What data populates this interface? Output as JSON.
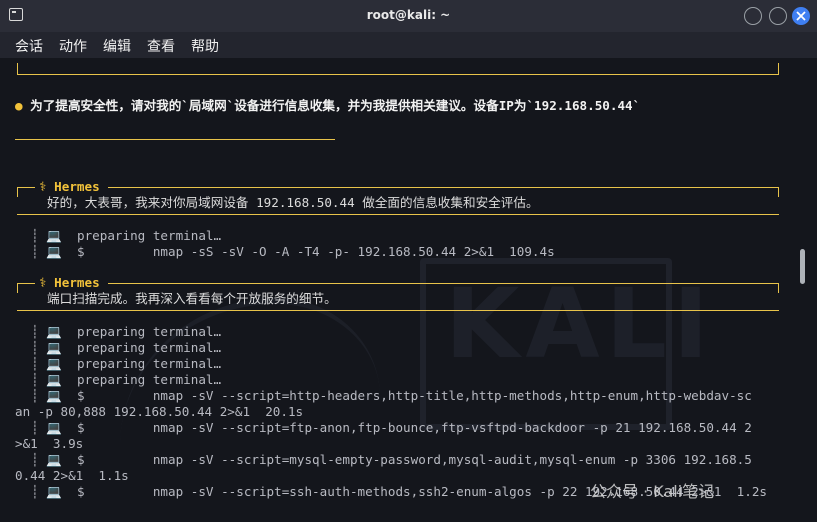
{
  "window": {
    "title": "root@kali: ~",
    "accent_close": "#3f7ff2"
  },
  "menu": [
    "会话",
    "动作",
    "编辑",
    "查看",
    "帮助"
  ],
  "terminal": {
    "user_prompt": "为了提高安全性，请对我的`局域网`设备进行信息收集，并为我提供相关建议。设备IP为`192.168.50.44`",
    "agent_name": "⚕ Hermes",
    "reply1": "好的，大表哥，我来对你局域网设备 192.168.50.44 做全面的信息收集和安全评估。",
    "block1": [
      "┊ 💻  preparing terminal…",
      "┊ 💻  $         nmap -sS -sV -O -A -T4 -p- 192.168.50.44 2>&1  109.4s"
    ],
    "reply2": "端口扫描完成。我再深入看看每个开放服务的细节。",
    "block2": [
      "┊ 💻  preparing terminal…",
      "┊ 💻  preparing terminal…",
      "┊ 💻  preparing terminal…",
      "┊ 💻  preparing terminal…",
      "┊ 💻  $         nmap -sV --script=http-headers,http-title,http-methods,http-enum,http-webdav-sc",
      "an -p 80,888 192.168.50.44 2>&1  20.1s",
      "┊ 💻  $         nmap -sV --script=ftp-anon,ftp-bounce,ftp-vsftpd-backdoor -p 21 192.168.50.44 2",
      ">&1  3.9s",
      "┊ 💻  $         nmap -sV --script=mysql-empty-password,mysql-audit,mysql-enum -p 3306 192.168.5",
      "0.44 2>&1  1.1s",
      "┊ 💻  $         nmap -sV --script=ssh-auth-methods,ssh2-enum-algos -p 22 192.168.50.44 2>&1  1.2s"
    ],
    "watermark": "KALI",
    "footer_mark": "公众号 · Kali笔记"
  }
}
